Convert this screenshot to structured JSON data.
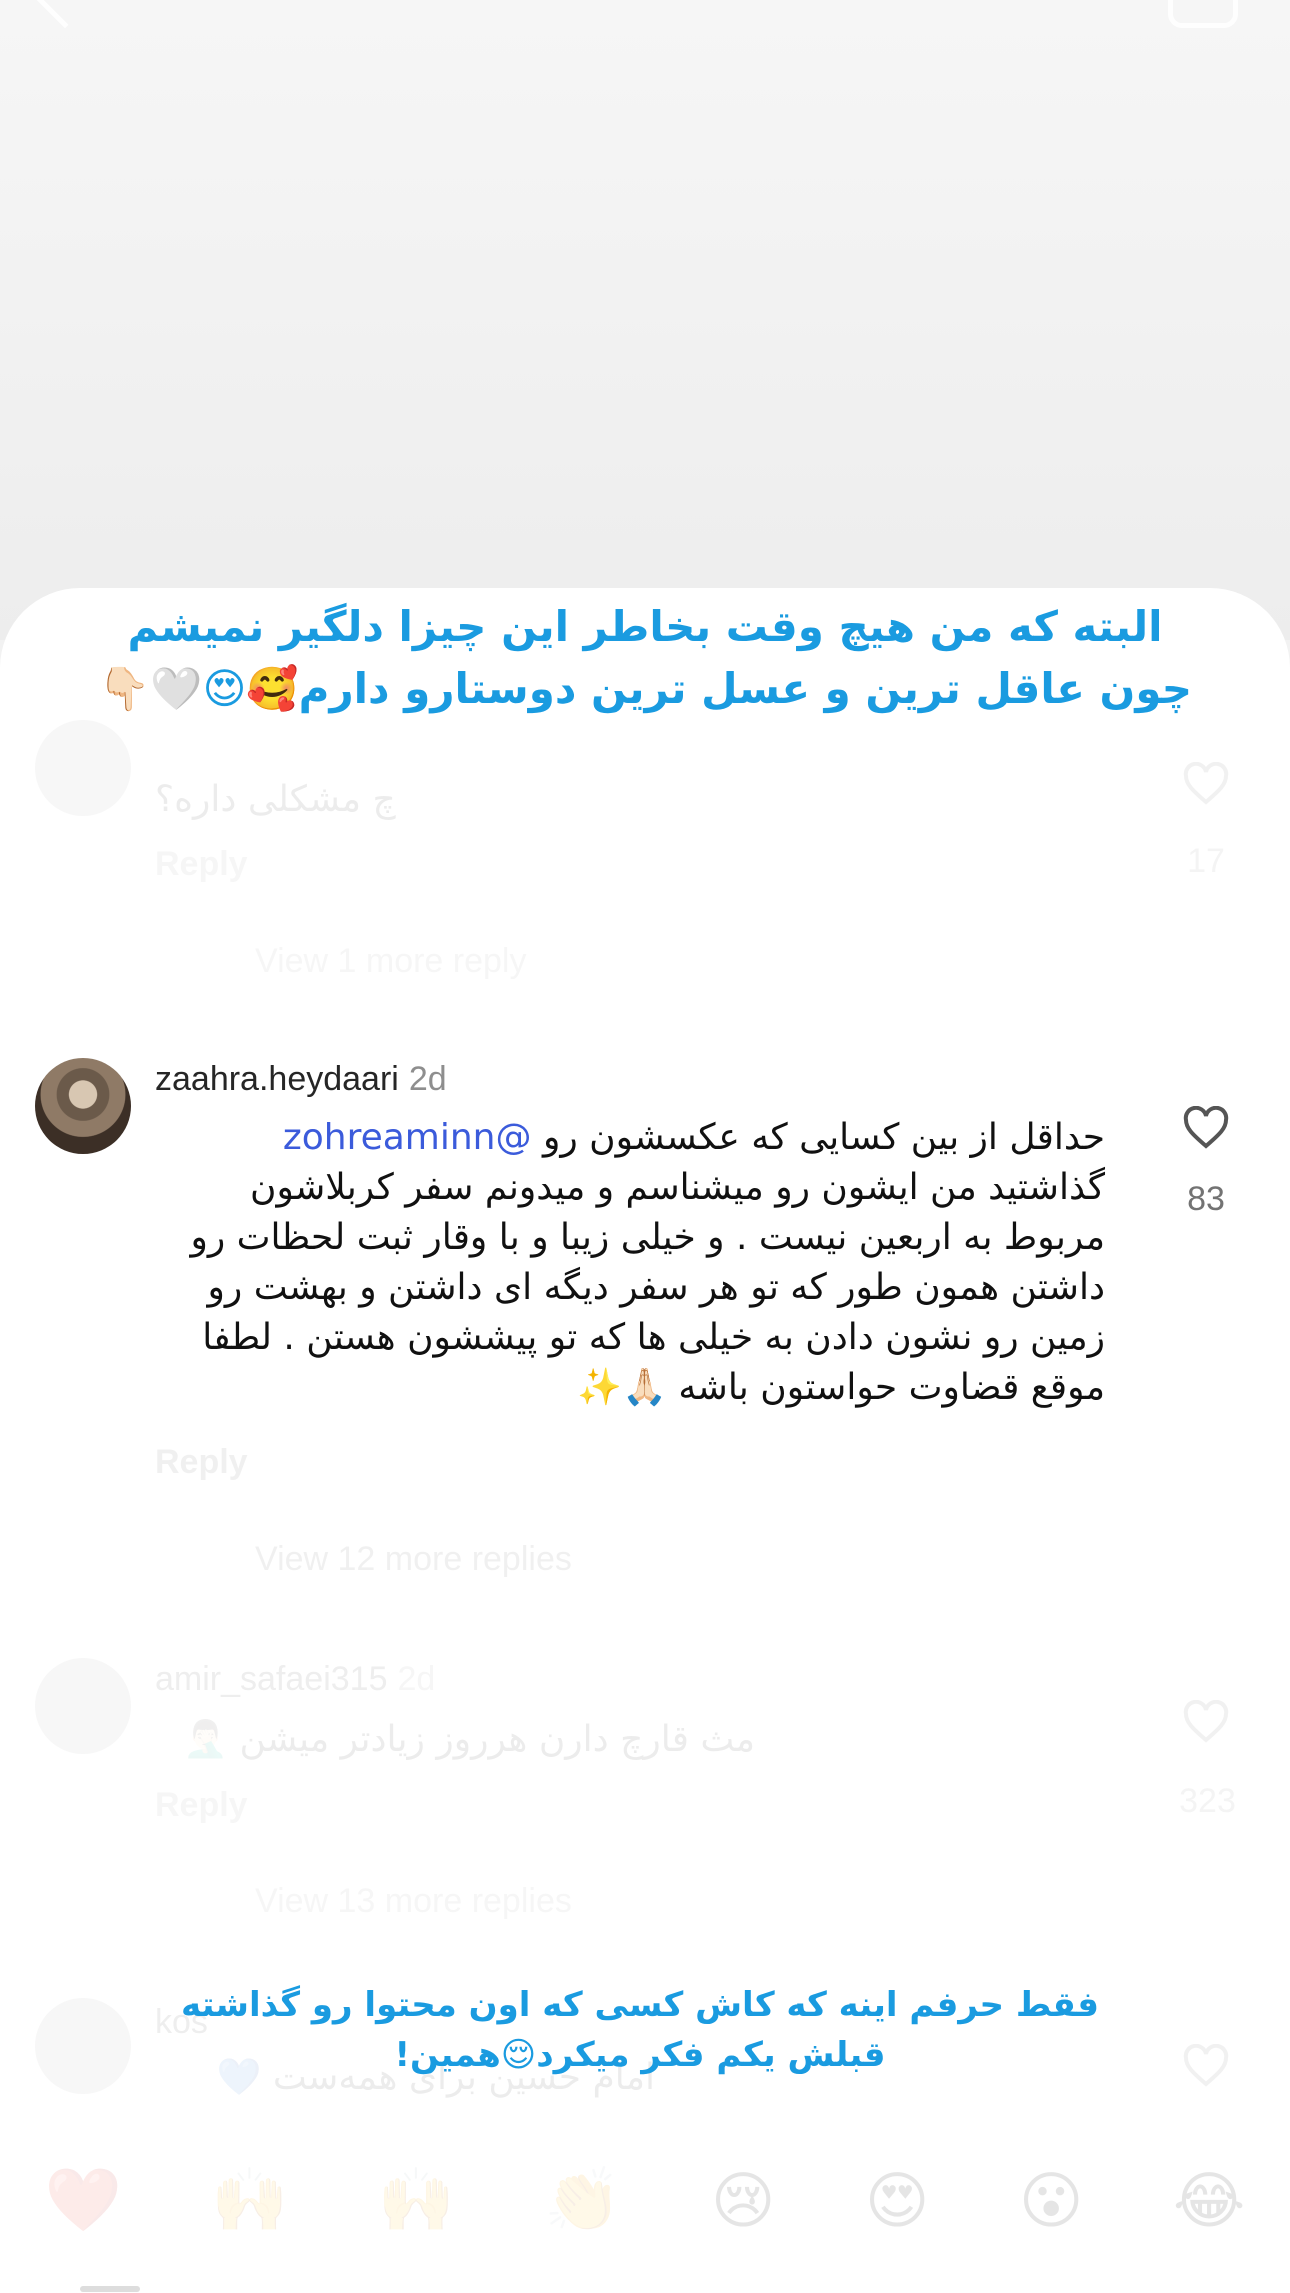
{
  "overlay_top": {
    "line1": "البته که من هیچ وقت بخاطر این چیزا دلگیر نمیشم",
    "line2": "چون عاقل ترین و  عسل ترین دوستارو دارم🥰😍🤍👇🏻"
  },
  "comments": [
    {
      "text": "چ مشکلی داره؟",
      "reply": "Reply",
      "likes": "17",
      "view_more": "View 1 more reply"
    },
    {
      "username": "zaahra.heydaari",
      "time": "2d",
      "mention": "@zohreaminn",
      "text_line1": "حداقل از بین کسایی که عکسشون رو",
      "text_rest": "گذاشتید من ایشون رو میشناسم و میدونم سفر کربلاشون مربوط به اربعین نیست . و خیلی زیبا و با وقار ثبت لحظات رو داشتن همون طور که تو هر سفر دیگه ای داشتن و بهشت رو زمین رو نشون دادن به خیلی ها که تو پیششون هستن . لطفا موقع قضاوت حواستون باشه 🙏🏻✨",
      "reply": "Reply",
      "likes": "83",
      "view_more": "View 12 more replies"
    },
    {
      "username": "amir_safaei315",
      "time": "2d",
      "text": "مث قارچ دارن هرروز زیادتر میشن 🤦🏻‍♂️",
      "reply": "Reply",
      "likes": "323",
      "view_more": "View 13 more replies"
    },
    {
      "username": "kos",
      "text": "امام حسین برای همه‌ست 💙"
    }
  ],
  "overlay_bottom": {
    "line1": "فقط حرفم اینه  که کاش کسی که اون محتوا رو گذاشته",
    "line2": "قبلش یکم فکر میکرد😌همین!"
  },
  "emoji_bar": [
    "❤️",
    "🙌",
    "🙌",
    "👏",
    "😢",
    "😍",
    "😮",
    "😂"
  ],
  "colors": {
    "overlay_text": "#1a9be0",
    "mention": "#3b5bdb",
    "muted": "#8e8e8e"
  }
}
